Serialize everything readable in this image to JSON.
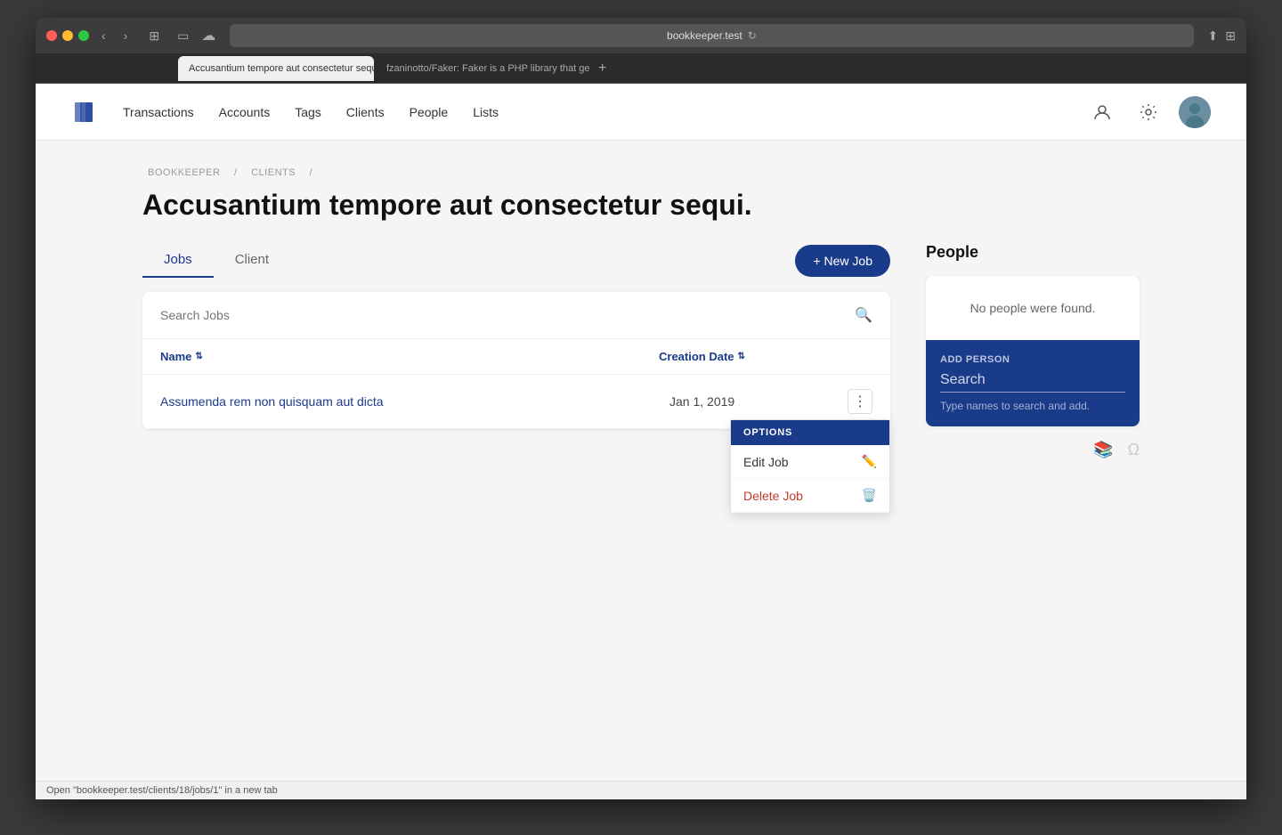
{
  "browser": {
    "url": "bookkeeper.test",
    "tab1_label": "Accusantium tempore aut consectetur sequi. — Bookkeeper",
    "tab2_label": "fzaninotto/Faker: Faker is a PHP library that generates fake data for you",
    "status_bar": "Open \"bookkeeper.test/clients/18/jobs/1\" in a new tab"
  },
  "nav": {
    "logo_icon": "book-icon",
    "links": [
      {
        "label": "Transactions",
        "id": "transactions"
      },
      {
        "label": "Accounts",
        "id": "accounts"
      },
      {
        "label": "Tags",
        "id": "tags"
      },
      {
        "label": "Clients",
        "id": "clients"
      },
      {
        "label": "People",
        "id": "people"
      },
      {
        "label": "Lists",
        "id": "lists"
      }
    ]
  },
  "breadcrumb": {
    "items": [
      "BOOKKEEPER",
      "CLIENTS"
    ]
  },
  "page": {
    "title": "Accusantium tempore aut consectetur sequi.",
    "tabs": [
      {
        "label": "Jobs",
        "id": "jobs",
        "active": true
      },
      {
        "label": "Client",
        "id": "client",
        "active": false
      }
    ],
    "new_job_label": "+ New Job"
  },
  "jobs_table": {
    "search_placeholder": "Search Jobs",
    "col_name": "Name",
    "col_date": "Creation Date",
    "sort_icon": "⇅",
    "rows": [
      {
        "name": "Assumenda rem non quisquam aut dicta",
        "date": "Jan 1, 2019"
      }
    ]
  },
  "dropdown": {
    "header": "OPTIONS",
    "items": [
      {
        "label": "Edit Job",
        "icon": "edit-icon",
        "danger": false
      },
      {
        "label": "Delete Job",
        "icon": "trash-icon",
        "danger": true
      }
    ]
  },
  "people_panel": {
    "title": "People",
    "no_people_text": "No people were found.",
    "add_person_label": "ADD PERSON",
    "search_placeholder": "Search",
    "search_hint": "Type names to search and add."
  },
  "colors": {
    "primary": "#1a3a8a",
    "danger": "#c0392b",
    "text_dark": "#111",
    "text_medium": "#444",
    "text_light": "#999"
  }
}
